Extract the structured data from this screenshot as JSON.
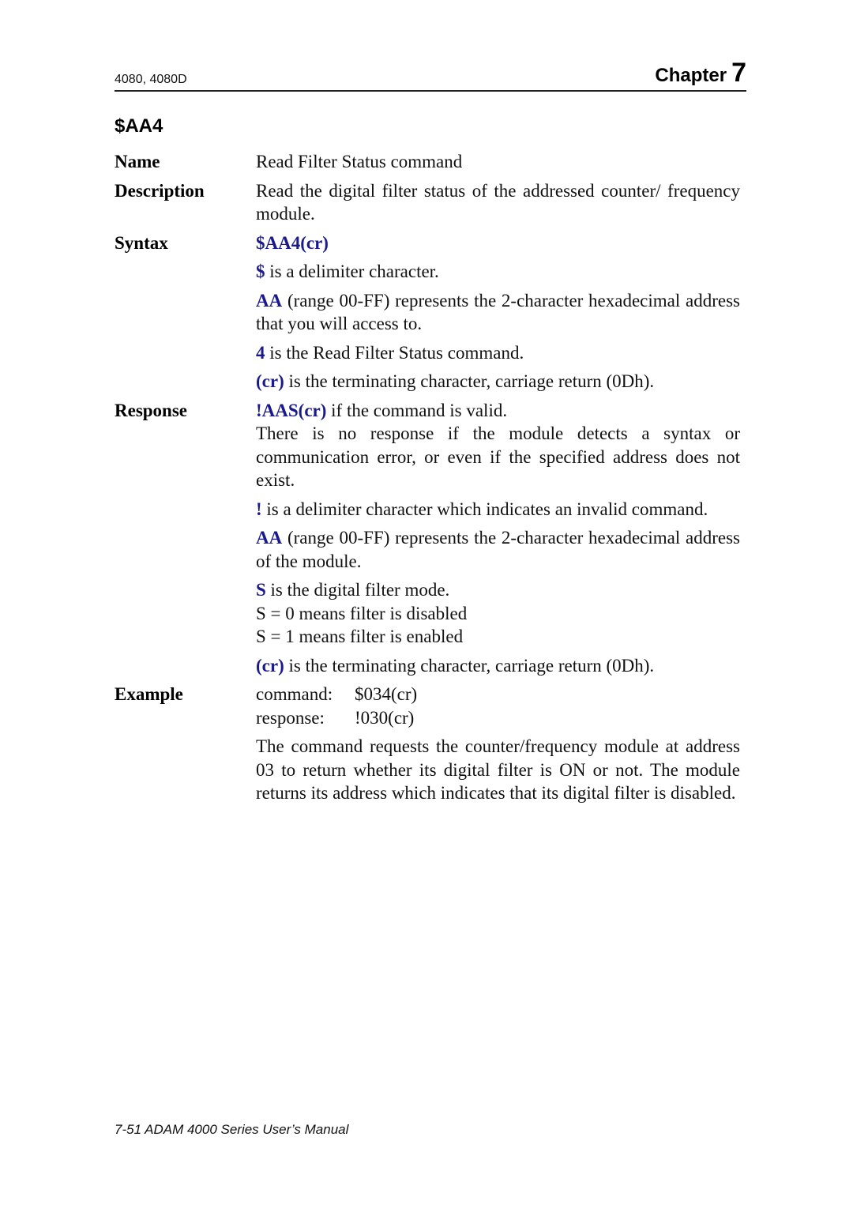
{
  "header": {
    "models": "4080, 4080D",
    "chapter_label": "Chapter",
    "chapter_number": "7"
  },
  "command_title": "$AA4",
  "sections": {
    "name": {
      "label": "Name",
      "text": "Read Filter Status command"
    },
    "description": {
      "label": "Description",
      "text": "Read the digital filter status of the addressed counter/ frequency module."
    },
    "syntax": {
      "label": "Syntax",
      "command": "$AA4(cr)",
      "items": [
        {
          "key": "$",
          "text": " is a delimiter character."
        },
        {
          "key": "AA",
          "text": " (range 00-FF) represents the 2-character hexadecimal address that you will access to."
        },
        {
          "key": "4",
          "text": " is the Read Filter Status command."
        },
        {
          "key": "(cr)",
          "text": " is the terminating character, carriage return (0Dh)."
        }
      ]
    },
    "response": {
      "label": "Response",
      "valid_key": "!AAS(cr)",
      "valid_text": " if the command is valid.",
      "no_response_text": "There is no response if the module detects a syntax or communication error, or even if the specified address does not exist.",
      "items": [
        {
          "key": "!",
          "text": " is a delimiter character which indicates an invalid command."
        },
        {
          "key": "AA",
          "text": " (range 00-FF) represents the 2-character hexadecimal address of the module."
        },
        {
          "key": "S",
          "text": " is the digital filter mode."
        },
        {
          "key": "(cr)",
          "text": " is the terminating character, carriage return (0Dh)."
        }
      ],
      "s_values": [
        "S = 0 means filter is disabled",
        "S = 1 means filter is enabled"
      ]
    },
    "example": {
      "label": "Example",
      "command_key": "command:",
      "command_value": "$034(cr)",
      "response_key": "response:",
      "response_value": "!030(cr)",
      "explanation": "The command requests the counter/frequency module at address 03 to return whether its digital filter is ON or not. The module returns its address which indicates that its digital filter is disabled."
    }
  },
  "footer": {
    "text": "7-51 ADAM 4000 Series User’s Manual"
  },
  "colors": {
    "keyword_blue": "#1a1a8c",
    "text": "#111111",
    "rule": "#222222"
  }
}
